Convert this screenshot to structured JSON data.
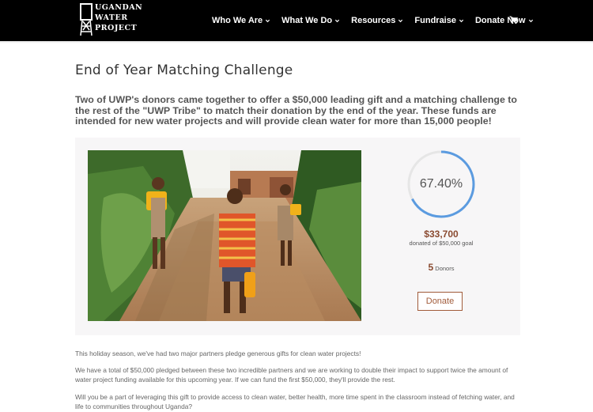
{
  "header": {
    "logo_lines": [
      "UGANDAN",
      "WATER",
      "PROJECT"
    ],
    "nav": [
      {
        "label": "Who We Are",
        "icon": "chevron-down-icon"
      },
      {
        "label": "What We Do",
        "icon": "chevron-down-icon"
      },
      {
        "label": "Resources",
        "icon": "chevron-down-icon"
      },
      {
        "label": "Fundraise",
        "icon": "chevron-down-icon"
      },
      {
        "label": "Donate Now",
        "icon": "chevron-down-icon"
      }
    ],
    "cart_icon": "cart-icon"
  },
  "page": {
    "title": "End of Year Matching Challenge",
    "lead": "Two of UWP's donors came together to offer a $50,000 leading gift and a matching challenge to the rest of the \"UWP Tribe\" to match their donation by the end of the year. These funds are intended for new water projects and will provide clean water for more than 15,000 people!"
  },
  "campaign": {
    "progress": 0.674,
    "progress_label": "67.40%",
    "raised": "$33,700",
    "goal_text": "donated of $50,000 goal",
    "donor_count": "5",
    "donor_label": "Donors",
    "donate_label": "Donate"
  },
  "body": {
    "p1": "This holiday season, we've had two major partners pledge generous gifts for clean water projects!",
    "p2": "We have a total of $50,000 pledged between these two incredible partners and we are working to double their impact to support twice the amount of water project funding available for this upcoming year. If we can fund the first $50,000, they'll provide the rest.",
    "p3": "Will you be a part of leveraging this gift to provide access to clean water, better health, more time spent in the classroom instead of fetching water, and life to communities throughout Uganda?"
  },
  "colors": {
    "accent": "#a15b3a",
    "ring": "#5b9be0",
    "ring_track": "#e6e6e6",
    "header_bg": "#000000"
  }
}
